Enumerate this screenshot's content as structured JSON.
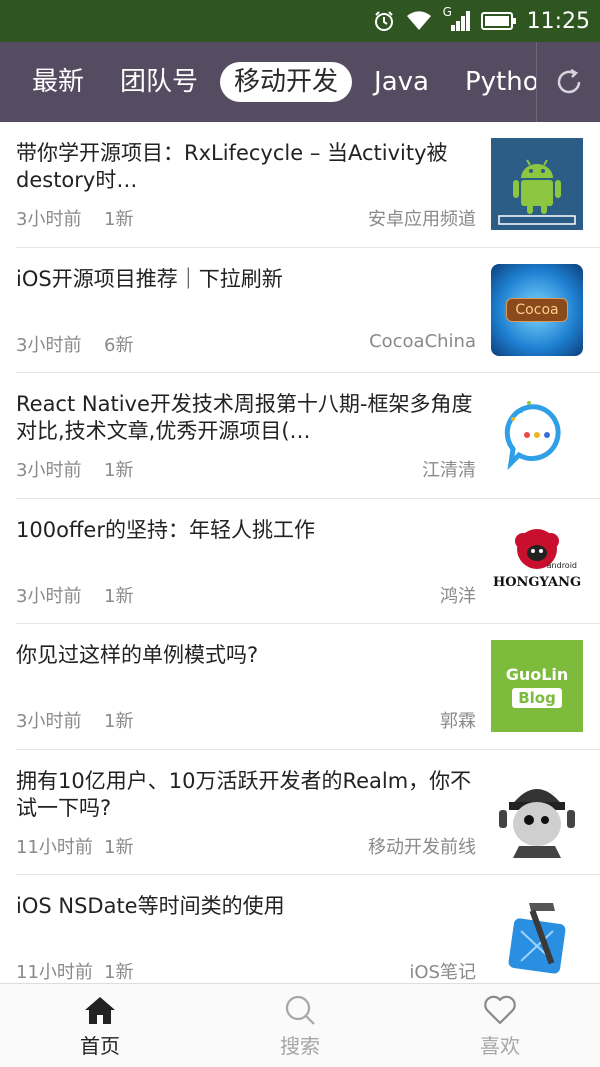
{
  "status_bar": {
    "time": "11:25",
    "signal_label": "G"
  },
  "tabs": [
    {
      "label": "最新",
      "active": false
    },
    {
      "label": "团队号",
      "active": false
    },
    {
      "label": "移动开发",
      "active": true
    },
    {
      "label": "Java",
      "active": false
    },
    {
      "label": "Python",
      "active": false
    }
  ],
  "feed": [
    {
      "title": "带你学开源项目：RxLifecycle – 当Activity被destory时…",
      "time": "3小时前",
      "count": "1新",
      "source": "安卓应用频道",
      "thumb": "android-logo"
    },
    {
      "title": "iOS开源项目推荐｜下拉刷新",
      "time": "3小时前",
      "count": "6新",
      "source": "CocoaChina",
      "thumb": "cocoa-logo"
    },
    {
      "title": "React Native开发技术周报第十八期-框架多角度对比,技术文章,优秀开源项目(…",
      "time": "3小时前",
      "count": "1新",
      "source": "江清清",
      "thumb": "chat-bubble-logo"
    },
    {
      "title": "100offer的坚持：年轻人挑工作",
      "time": "3小时前",
      "count": "1新",
      "source": "鸿洋",
      "thumb": "hongyang-logo"
    },
    {
      "title": "你见过这样的单例模式吗?",
      "time": "3小时前",
      "count": "1新",
      "source": "郭霖",
      "thumb": "guolin-blog-logo"
    },
    {
      "title": "拥有10亿用户、10万活跃开发者的Realm，你不试一下吗?",
      "time": "11小时前",
      "count": "1新",
      "source": "移动开发前线",
      "thumb": "cat-avatar"
    },
    {
      "title": "iOS NSDate等时间类的使用",
      "time": "11小时前",
      "count": "1新",
      "source": "iOS笔记",
      "thumb": "xcode-hammer-icon"
    }
  ],
  "thumb_logos": {
    "cocoa": "Cocoa",
    "hongyang": "HONGYANG",
    "hongyang_small": "android",
    "guolin_1": "GuoLin",
    "guolin_2": "Blog"
  },
  "bottom_nav": [
    {
      "label": "首页",
      "icon": "home-icon",
      "active": true
    },
    {
      "label": "搜索",
      "icon": "search-icon",
      "active": false
    },
    {
      "label": "喜欢",
      "icon": "heart-icon",
      "active": false
    }
  ],
  "colors": {
    "status_bar": "#2f5620",
    "tab_bar": "#554c61",
    "text_primary": "#222222",
    "text_secondary": "#8a8a8a"
  }
}
